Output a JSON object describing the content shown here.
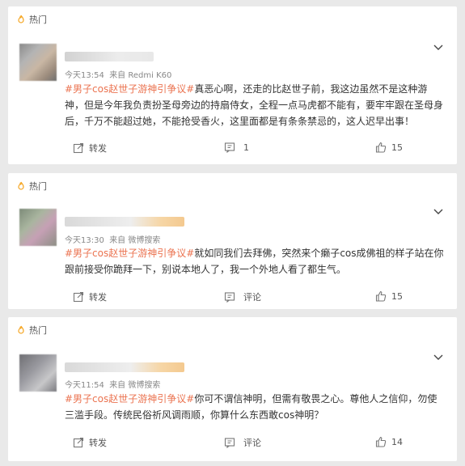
{
  "posts": [
    {
      "hot_label": "热门",
      "time": "今天13:54",
      "source": "来自 Redmi K60",
      "hashtag": "#男子cos赵世子游神引争议#",
      "text": "真恶心啊，还走的比赵世子前，我这边虽然不是这种游神，但是今年我负责扮圣母旁边的持扇侍女，全程一点马虎都不能有，要牢牢跟在圣母身后，千万不能超过她，不能抢受香火，这里面都是有条条禁忌的，这人迟早出事！",
      "repost_label": "转发",
      "comment_label": "1",
      "like_count": "15"
    },
    {
      "hot_label": "热门",
      "time": "今天13:30",
      "source": "来自 微博搜索",
      "hashtag": "#男子cos赵世子游神引争议#",
      "text": "就如同我们去拜佛，突然来个癞子cos成佛祖的样子站在你跟前接受你跪拜一下，别说本地人了，我一个外地人看了都生气。",
      "repost_label": "转发",
      "comment_label": "评论",
      "like_count": "15"
    },
    {
      "hot_label": "热门",
      "time": "今天11:54",
      "source": "来自 微博搜索",
      "hashtag": "#男子cos赵世子游神引争议#",
      "text": "你可不谓信神明，但需有敬畏之心。尊他人之信仰，勿使三滥手段。传统民俗祈风调雨顺，你算什么东西敢cos神明？",
      "repost_label": "转发",
      "comment_label": "评论",
      "like_count": "14"
    }
  ],
  "colors": {
    "accent": "#eb7350",
    "background": "#e9e9e9",
    "card": "#ffffff"
  }
}
